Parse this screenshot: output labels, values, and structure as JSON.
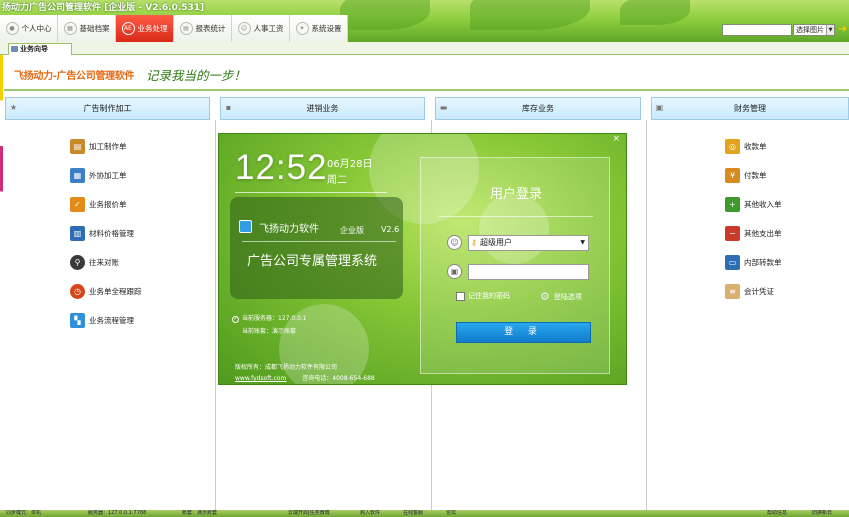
{
  "window": {
    "title": "扬动力广告公司管理软件 [企业版 - V2.6.0.531]"
  },
  "menu": [
    {
      "label": "个人中心",
      "icon": "person-icon"
    },
    {
      "label": "基础档案",
      "icon": "archive-icon"
    },
    {
      "label": "业务处理",
      "icon": "ae-icon",
      "icon_text": "AE",
      "active": true
    },
    {
      "label": "报表统计",
      "icon": "report-icon"
    },
    {
      "label": "人事工资",
      "icon": "hr-icon"
    },
    {
      "label": "系统设置",
      "icon": "settings-icon"
    }
  ],
  "search": {
    "value": "",
    "select_label": "选择图片"
  },
  "tab": {
    "label": "业务向导"
  },
  "brand": {
    "name": "飞扬动力-广告公司管理软件",
    "slogan": "记录我当的一步！"
  },
  "columns": [
    {
      "header": "广告制作加工",
      "icon": "star-icon",
      "items": [
        {
          "label": "加工制作单",
          "icon": "clipboard-icon",
          "color": "#c98a2a"
        },
        {
          "label": "外协加工单",
          "icon": "document-icon",
          "color": "#3c7fc4"
        },
        {
          "label": "业务报价单",
          "icon": "checklist-icon",
          "color": "#e38b18"
        },
        {
          "label": "材料价格管理",
          "icon": "book-icon",
          "color": "#2e6db4"
        },
        {
          "label": "往来对账",
          "icon": "magnifier-icon",
          "color": "#3a3a3a"
        },
        {
          "label": "业务单全程跟踪",
          "icon": "clock-icon",
          "color": "#d5471a"
        },
        {
          "label": "业务流程管理",
          "icon": "flow-icon",
          "color": "#2f8fd8"
        }
      ]
    },
    {
      "header": "进销业务",
      "icon": "flag-icon",
      "items": []
    },
    {
      "header": "库存业务",
      "icon": "box-icon",
      "items": []
    },
    {
      "header": "财务管理",
      "icon": "money-icon",
      "items": [
        {
          "label": "收款单",
          "icon": "coins-icon",
          "color": "#e0a51c"
        },
        {
          "label": "付款单",
          "icon": "hand-coin-icon",
          "color": "#d98a1f"
        },
        {
          "label": "其他收入单",
          "icon": "income-icon",
          "color": "#3f9a2e"
        },
        {
          "label": "其他支出单",
          "icon": "expense-icon",
          "color": "#c83a2a"
        },
        {
          "label": "内部转款单",
          "icon": "card-icon",
          "color": "#2d6fb3"
        },
        {
          "label": "会计凭证",
          "icon": "voucher-icon",
          "color": "#d9b071"
        }
      ]
    }
  ],
  "login": {
    "close": "×",
    "time": "12:52",
    "date": "06月28日",
    "weekday": "周二",
    "product_name": "飞扬动力软件",
    "edition": "企业版",
    "version": "V2.6",
    "product_title": "广告公司专属管理系统",
    "server_label": "当前服务器：127.0.0.1",
    "account_label": "当前账套：演示账套",
    "copyright": "版权所有：成都飞扬动力软件有限公司",
    "website": "www.fydsoft.com",
    "phone": "咨询电话：4008-654-688",
    "panel_title": "用户登录",
    "user_value": "超级用户",
    "password_value": "",
    "remember_label": "记住我的密码",
    "options_label": "登陆选项",
    "login_button": "登 录"
  },
  "status": [
    "同步模式：单机",
    "服务器：127.0.0.1:7788",
    "账套：演示账套",
    "云端开启|任务微博",
    "购入软件",
    "在线客服",
    "论坛",
    "帮助信息",
    "旧换新日"
  ]
}
